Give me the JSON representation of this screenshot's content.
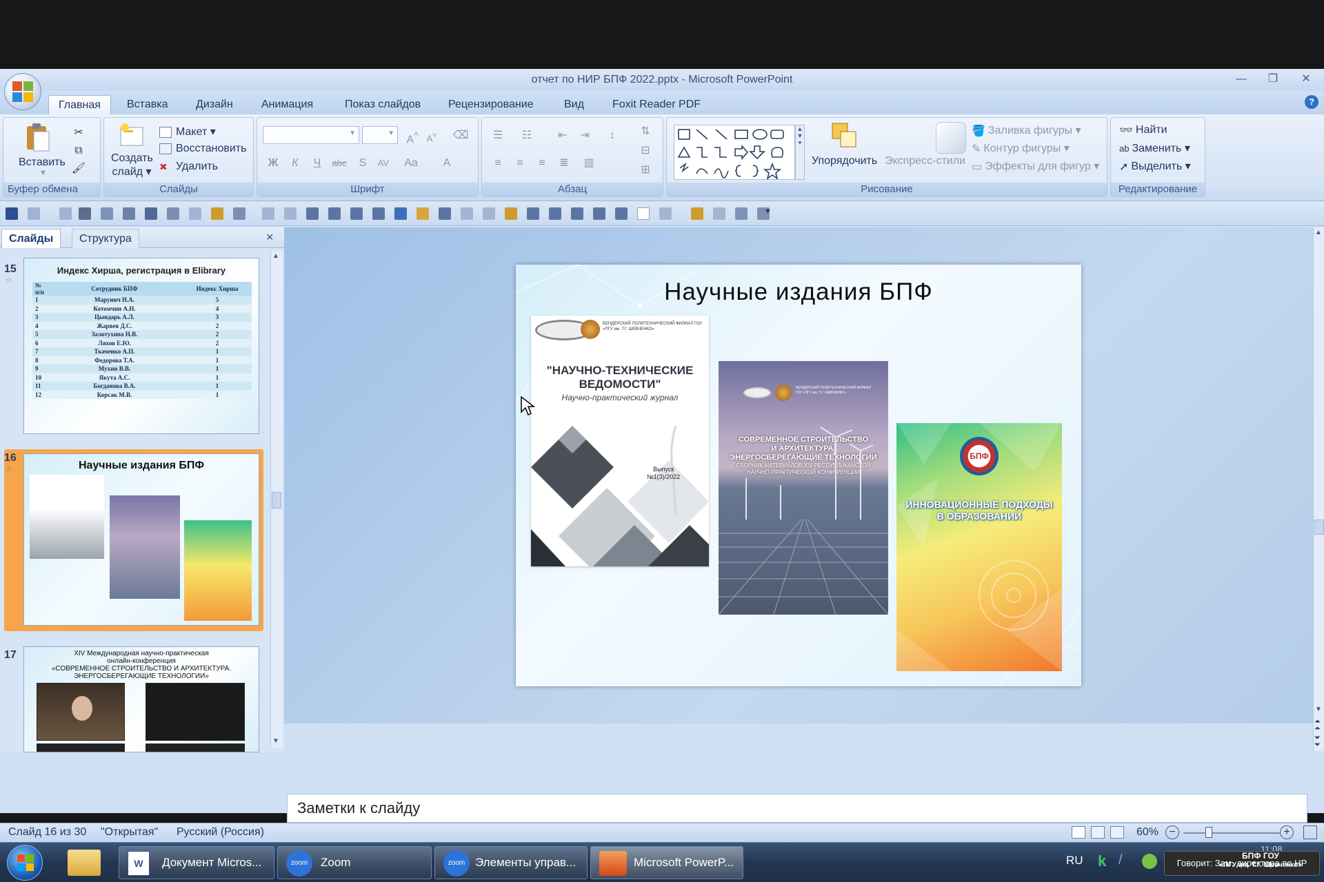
{
  "window": {
    "title": "отчет по НИР БПФ 2022.pptx - Microsoft PowerPoint"
  },
  "tabs": [
    "Главная",
    "Вставка",
    "Дизайн",
    "Анимация",
    "Показ слайдов",
    "Рецензирование",
    "Вид",
    "Foxit Reader PDF"
  ],
  "ribbon": {
    "clipboard": {
      "paste": "Вставить",
      "label": "Буфер обмена"
    },
    "slides": {
      "create": "Создать",
      "create2": "слайд",
      "layout": "Макет",
      "reset": "Восстановить",
      "delete": "Удалить",
      "label": "Слайды"
    },
    "font": {
      "label": "Шрифт",
      "bold": "Ж",
      "italic": "К",
      "underline": "Ч",
      "strike": "abc",
      "shadow": "S",
      "spacing": "AV",
      "case": "Aa",
      "color": "A"
    },
    "paragraph": {
      "label": "Абзац"
    },
    "drawing": {
      "arrange": "Упорядочить",
      "styles": "Экспресс-стили",
      "fill": "Заливка фигуры",
      "outline": "Контур фигуры",
      "effects": "Эффекты для фигур",
      "label": "Рисование"
    },
    "editing": {
      "find": "Найти",
      "replace": "Заменить",
      "select": "Выделить",
      "label": "Редактирование"
    }
  },
  "left_pane": {
    "tab_slides": "Слайды",
    "tab_outline": "Структура",
    "close": "×",
    "slide15": {
      "num": "15",
      "title": "Индекс Хирша, регистрация в Elibrary",
      "headers": [
        "№ п/п",
        "Сотрудник БПФ",
        "Индекс Хирша"
      ],
      "rows": [
        [
          "1",
          "Марунич Н.А.",
          "5"
        ],
        [
          "2",
          "Котомчин А.Н.",
          "4"
        ],
        [
          "3",
          "Цындарь А.Л.",
          "3"
        ],
        [
          "4",
          "Жарвев Д.С.",
          "2"
        ],
        [
          "5",
          "Залотухина Н.В.",
          "2"
        ],
        [
          "6",
          "Ляхов Е.Ю.",
          "2"
        ],
        [
          "7",
          "Ткаченко А.П.",
          "1"
        ],
        [
          "8",
          "Федорова Т.А.",
          "1"
        ],
        [
          "9",
          "Мухин В.В.",
          "1"
        ],
        [
          "10",
          "Якута А.С.",
          "1"
        ],
        [
          "11",
          "Богданова В.А.",
          "1"
        ],
        [
          "12",
          "Корсак М.В.",
          "1"
        ]
      ]
    },
    "slide16": {
      "num": "16",
      "title": "Научные издания БПФ"
    },
    "slide17": {
      "num": "17",
      "line1": "XIV Международная научно-практическая",
      "line2": "онлайн-конференция",
      "line3": "«СОВРЕМЕННОЕ СТРОИТЕЛЬСТВО И АРХИТЕКТУРА.",
      "line4": "ЭНЕРГОСБЕРЕГАЮЩИЕ ТЕХНОЛОГИИ»"
    }
  },
  "slide": {
    "title": "Научные издания БПФ",
    "cover1": {
      "org": "БЕНДЕРСКИЙ ПОЛИТЕХНИЧЕСКИЙ ФИЛИАЛ ГОУ «ПГУ им. Т.Г. ШЕВЧЕНКО»",
      "title1": "\"НАУЧНО-ТЕХНИЧЕСКИЕ",
      "title2": "ВЕДОМОСТИ\"",
      "subtitle": "Научно-практический журнал",
      "issue1": "Выпуск",
      "issue2": "№1(3)/2022"
    },
    "cover2": {
      "org": "БЕНДЕРСКИЙ ПОЛИТЕХНИЧЕСКИЙ ФИЛИАЛ ГОУ «ПГУ им. Т.Г. ШЕВЧЕНКО»",
      "line1": "СОВРЕМЕННОЕ СТРОИТЕЛЬСТВО",
      "line2": "И АРХИТЕКТУРА.",
      "line3": "ЭНЕРГОСБЕРЕГАЮЩИЕ ТЕХНОЛОГИИ",
      "line4": "СБОРНИК МАТЕРИАЛОВ XIV РЕСПУБЛИКАНСКОЙ",
      "line5": "НАУЧНО-ПРАКТИЧЕСКОЙ КОНФЕРЕНЦИИ"
    },
    "cover3": {
      "logo": "БПФ",
      "line1": "ИННОВАЦИОННЫЕ ПОДХОДЫ",
      "line2": "В ОБРАЗОВАНИИ"
    }
  },
  "notes": {
    "placeholder": "Заметки к слайду"
  },
  "status": {
    "slide": "Слайд 16 из 30",
    "theme": "\"Открытая\"",
    "lang": "Русский (Россия)",
    "zoom": "60%"
  },
  "taskbar": {
    "items": [
      "Документ Micros...",
      "Zoom",
      "Элементы управ...",
      "Microsoft PowerP..."
    ],
    "zoom_logo": "zoom",
    "lang": "RU",
    "time": "11:08",
    "speaking": "Говорит: Зам. директора по НР"
  },
  "watermark": {
    "line1": "БПФ ГОУ",
    "line2": "«ПГУ им. Т.Г. Шевченко»"
  }
}
